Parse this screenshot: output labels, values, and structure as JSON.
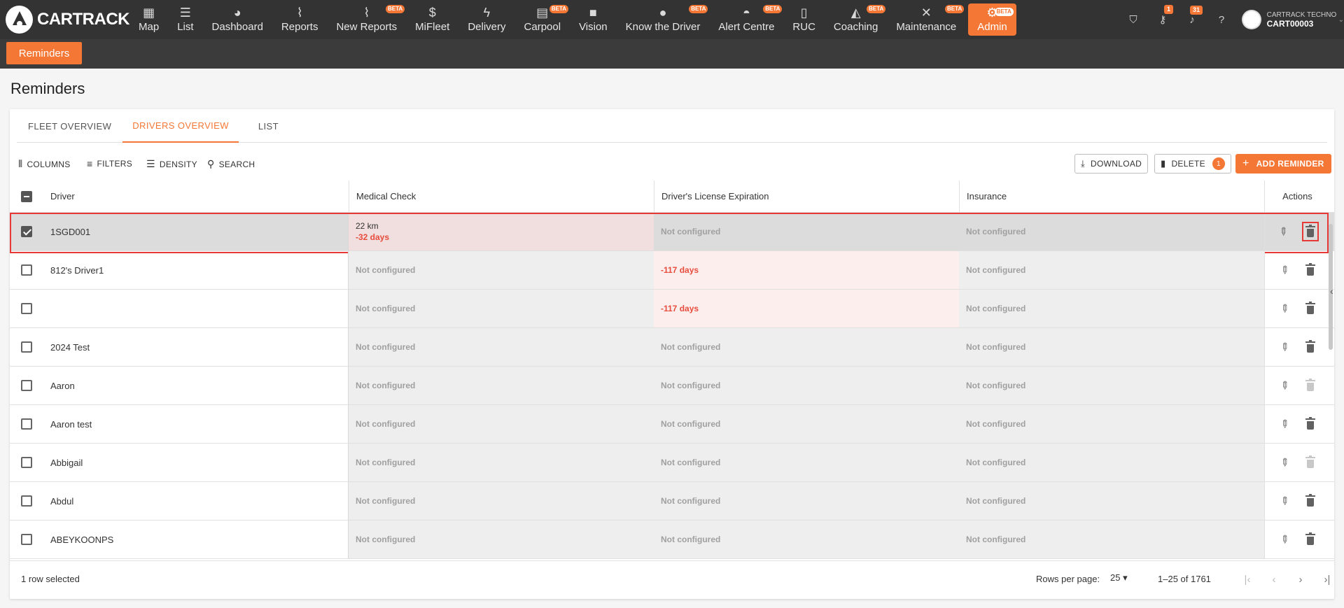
{
  "brand": "CARTRACK",
  "nav": [
    {
      "label": "Map",
      "icon": "map-icon",
      "glyph": "▦",
      "beta": ""
    },
    {
      "label": "List",
      "icon": "list-icon",
      "glyph": "☰",
      "beta": ""
    },
    {
      "label": "Dashboard",
      "icon": "dashboard-icon",
      "glyph": "◕",
      "beta": ""
    },
    {
      "label": "Reports",
      "icon": "reports-icon",
      "glyph": "⌇",
      "beta": ""
    },
    {
      "label": "New Reports",
      "icon": "new-reports-icon",
      "glyph": "⌇",
      "beta": "BETA"
    },
    {
      "label": "MiFleet",
      "icon": "dollar-icon",
      "glyph": "$",
      "beta": ""
    },
    {
      "label": "Delivery",
      "icon": "bolt-icon",
      "glyph": "ϟ",
      "beta": ""
    },
    {
      "label": "Carpool",
      "icon": "calendar-icon",
      "glyph": "▤",
      "beta": "BETA"
    },
    {
      "label": "Vision",
      "icon": "camera-icon",
      "glyph": "■",
      "beta": ""
    },
    {
      "label": "Know the Driver",
      "icon": "person-icon",
      "glyph": "●",
      "beta": "BETA"
    },
    {
      "label": "Alert Centre",
      "icon": "alert-icon",
      "glyph": "◓",
      "beta": "BETA"
    },
    {
      "label": "RUC",
      "icon": "document-icon",
      "glyph": "▯",
      "beta": ""
    },
    {
      "label": "Coaching",
      "icon": "graduation-icon",
      "glyph": "◭",
      "beta": "BETA"
    },
    {
      "label": "Maintenance",
      "icon": "tools-icon",
      "glyph": "✕",
      "beta": "BETA"
    }
  ],
  "admin": {
    "label": "Admin",
    "beta": "BETA"
  },
  "topright": {
    "badge_keys": "1",
    "badge_notifications": "31",
    "org": "CARTRACK TECHNOL...",
    "account": "CART00003"
  },
  "subnav": {
    "tab": "Reminders"
  },
  "page": {
    "title": "Reminders"
  },
  "tabs": [
    "FLEET OVERVIEW",
    "DRIVERS OVERVIEW",
    "LIST"
  ],
  "toolbar": {
    "columns": "COLUMNS",
    "filters": "FILTERS",
    "density": "DENSITY",
    "search": "SEARCH",
    "download": "DOWNLOAD",
    "delete": "DELETE",
    "delete_count": "1",
    "add": "ADD REMINDER"
  },
  "columns": {
    "driver": "Driver",
    "medical": "Medical Check",
    "license": "Driver's License Expiration",
    "insurance": "Insurance",
    "actions": "Actions"
  },
  "rows": [
    {
      "driver": "1SGD001",
      "medical": "22 km",
      "medical2": "-32 days",
      "license": "Not configured",
      "insurance": "Not configured"
    },
    {
      "driver": "812's Driver1",
      "medical": "Not configured",
      "license": "-117 days",
      "insurance": "Not configured"
    },
    {
      "driver": "",
      "medical": "Not configured",
      "license": "-117 days",
      "insurance": "Not configured"
    },
    {
      "driver": "2024 Test",
      "medical": "Not configured",
      "license": "Not configured",
      "insurance": "Not configured"
    },
    {
      "driver": "Aaron",
      "medical": "Not configured",
      "license": "Not configured",
      "insurance": "Not configured"
    },
    {
      "driver": "Aaron test",
      "medical": "Not configured",
      "license": "Not configured",
      "insurance": "Not configured"
    },
    {
      "driver": "Abbigail",
      "medical": "Not configured",
      "license": "Not configured",
      "insurance": "Not configured"
    },
    {
      "driver": "Abdul",
      "medical": "Not configured",
      "license": "Not configured",
      "insurance": "Not configured"
    },
    {
      "driver": "ABEYKOONPS",
      "medical": "Not configured",
      "license": "Not configured",
      "insurance": "Not configured"
    }
  ],
  "footer": {
    "selected": "1 row selected",
    "rows_per_page_label": "Rows per page:",
    "rows_per_page": "25",
    "range": "1–25 of 1761"
  },
  "colors": {
    "accent": "#f47735",
    "overdue": "#e74c3c",
    "topbar": "#333333"
  }
}
